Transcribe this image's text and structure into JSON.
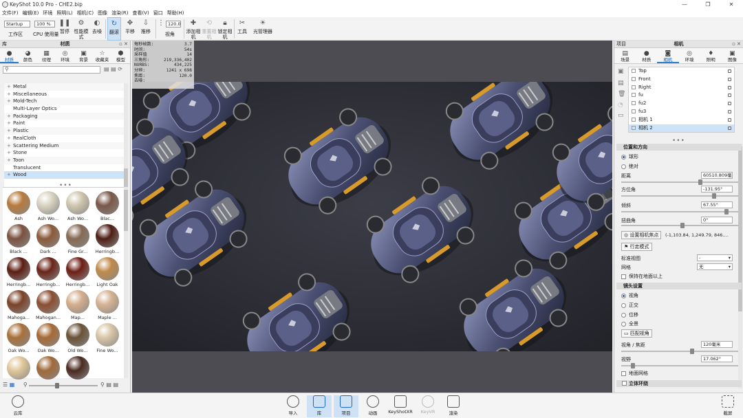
{
  "window": {
    "title": "KeyShot 10.0 Pro  - CHE2.bip",
    "controls": [
      "—",
      "❐",
      "✕"
    ]
  },
  "menu": [
    "文件(F)",
    "编辑(E)",
    "环境",
    "照明(L)",
    "相机(C)",
    "图像",
    "渲染(R)",
    "查看(V)",
    "窗口",
    "帮助(H)"
  ],
  "toolbar": {
    "workspace_select": "Startup",
    "workspace_label": "工作区",
    "cpu_label": "CPU 使用量",
    "cpu_value": "100 %",
    "pause": "暂停",
    "perf_mode": "性能模式",
    "denoise": "去噪",
    "tumble": "翻滚",
    "pan": "平移",
    "dolly": "推移",
    "fov_value": "120.0",
    "fov_label": "视角",
    "add_camera": "添加相机",
    "reset_camera": "重置相机",
    "lock_camera": "锁定相机",
    "tools": "工具",
    "light_manager": "光管理器"
  },
  "left_panel": {
    "left_header": "库",
    "title": "材质",
    "tabs": [
      "材质",
      "颜色",
      "纹理",
      "环境",
      "背景",
      "收藏夹",
      "模型"
    ],
    "tree": [
      {
        "label": "Metal",
        "expander": "+"
      },
      {
        "label": "Miscellaneous",
        "expander": "+"
      },
      {
        "label": "Mold-Tech",
        "expander": "+"
      },
      {
        "label": "Multi-Layer Optics",
        "expander": ""
      },
      {
        "label": "Packaging",
        "expander": "+"
      },
      {
        "label": "Paint",
        "expander": "+"
      },
      {
        "label": "Plastic",
        "expander": "+"
      },
      {
        "label": "RealCloth",
        "expander": "+"
      },
      {
        "label": "Scattering Medium",
        "expander": "+"
      },
      {
        "label": "Stone",
        "expander": "+"
      },
      {
        "label": "Toon",
        "expander": "+"
      },
      {
        "label": "Translucent",
        "expander": ""
      },
      {
        "label": "Wood",
        "expander": "+",
        "selected": true
      }
    ],
    "swatches": [
      {
        "label": "Ash",
        "color": "#b77a3c"
      },
      {
        "label": "Ash Wo...",
        "color": "#d8d2c0"
      },
      {
        "label": "Ash Wo...",
        "color": "#cfc6ae"
      },
      {
        "label": "Blac...",
        "color": "#7a5848"
      },
      {
        "label": "Black ...",
        "color": "#7a5240"
      },
      {
        "label": "Dark ...",
        "color": "#8b5a3a"
      },
      {
        "label": "Fine Gr...",
        "color": "#866a55"
      },
      {
        "label": "Herringb...",
        "color": "#4e1e14"
      },
      {
        "label": "Herringb...",
        "color": "#5c1d12"
      },
      {
        "label": "Herringb...",
        "color": "#6a2418"
      },
      {
        "label": "Herringb...",
        "color": "#6d1e14"
      },
      {
        "label": "Light Oak",
        "color": "#c08a4a"
      },
      {
        "label": "Mahoga...",
        "color": "#7a4228"
      },
      {
        "label": "Mahogan...",
        "color": "#8a4e30"
      },
      {
        "label": "Map...",
        "color": "#d4ae8c"
      },
      {
        "label": "Maple ...",
        "color": "#d6b294"
      },
      {
        "label": "Oak Wo...",
        "color": "#a8703a"
      },
      {
        "label": "Oak Wo...",
        "color": "#a66a36"
      },
      {
        "label": "Old Wo...",
        "color": "#6a5236"
      },
      {
        "label": "Fine Wo...",
        "color": "#d8c6a6"
      },
      {
        "label": "",
        "color": "#e0c79a"
      },
      {
        "label": "",
        "color": "#a06a3a"
      },
      {
        "label": "",
        "color": "#4a2a20"
      }
    ]
  },
  "hud": [
    [
      "每秒帧数:",
      "3.7"
    ],
    [
      "时间:",
      "54s"
    ],
    [
      "采样值",
      "14"
    ],
    [
      "三角形:",
      "219,336,402"
    ],
    [
      "NURBS:",
      "434,225"
    ],
    [
      "分辨:",
      "1241 x 698"
    ],
    [
      "焦距:",
      "120.0"
    ],
    [
      "去噪:",
      ""
    ]
  ],
  "right_panel": {
    "left_header": "项目",
    "title": "相机",
    "tabs": [
      "场景",
      "材质",
      "相机",
      "环境",
      "照明",
      "图像"
    ],
    "cameras": [
      {
        "label": "Top"
      },
      {
        "label": "Front"
      },
      {
        "label": "Right"
      },
      {
        "label": "fu"
      },
      {
        "label": "fu2"
      },
      {
        "label": "fu3"
      },
      {
        "label": "相机 1"
      },
      {
        "label": "相机 2",
        "selected": true
      }
    ],
    "pos_section": "位置和方向",
    "radio_spherical": "球形",
    "radio_absolute": "绝对",
    "distance_label": "距离",
    "distance_value": "60510.809毫米",
    "azimuth_label": "方位角",
    "azimuth_value": "-131.95°",
    "incl_label": "倾斜",
    "incl_value": "67.55°",
    "twist_label": "扭曲角",
    "twist_value": "0°",
    "set_focus_btn": "设置相机焦点",
    "focus_coords": "(-1,103.84, 1,249.79, 846.…",
    "walk_btn": "行走模式",
    "std_view_label": "标准视图",
    "std_view_value": "-",
    "grid_label": "网格",
    "grid_value": "无",
    "keep_above": "保持在地面以上",
    "lens_section": "镜头设置",
    "lens_options": [
      "视角",
      "正交",
      "位移",
      "全景"
    ],
    "match_btn": "匹配视角",
    "fov_focal_label": "视角 / 焦距",
    "fov_focal_value": "120毫米",
    "view_label": "视野",
    "view_value": "17.062°",
    "show_grid": "地面网格",
    "stereo_section": "立体环绕"
  },
  "bottom": {
    "cloud": "云库",
    "items": [
      "导入",
      "库",
      "项目",
      "动画",
      "KeyShotXR",
      "KeyVR",
      "渲染"
    ],
    "screenshot": "截屏"
  }
}
